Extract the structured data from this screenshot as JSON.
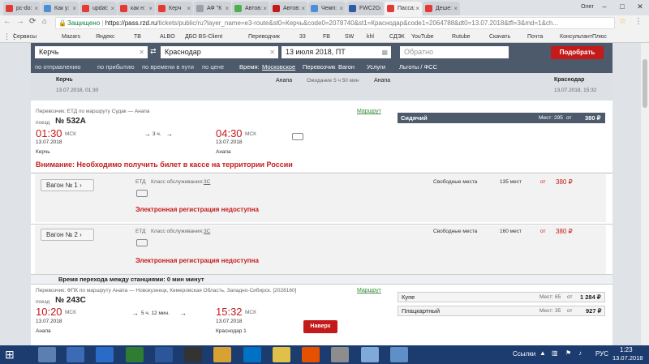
{
  "browser": {
    "tabs": [
      {
        "label": "pc-do:",
        "icon": "yandex-icon",
        "color": "#e53935"
      },
      {
        "label": "Как у:",
        "icon": "page-icon",
        "color": "#4a90d9"
      },
      {
        "label": "updat:",
        "icon": "yandex-icon",
        "color": "#e53935"
      },
      {
        "label": "как н:",
        "icon": "yandex-icon",
        "color": "#e53935"
      },
      {
        "label": "Керч",
        "icon": "rzd-icon",
        "color": "#e53935"
      },
      {
        "label": "АФ \"К",
        "icon": "page-icon",
        "color": "#9aa0a6"
      },
      {
        "label": "Автов:",
        "icon": "page-icon",
        "color": "#4caf50"
      },
      {
        "label": "Автов:",
        "icon": "page-icon",
        "color": "#c41a1a"
      },
      {
        "label": "Чемп:",
        "icon": "page-icon",
        "color": "#4a90d9"
      },
      {
        "label": "FWC2C",
        "icon": "page-icon",
        "color": "#2e5aa8"
      },
      {
        "label": "Пасса:",
        "icon": "rzd-icon",
        "color": "#e53935",
        "active": true
      },
      {
        "label": "Деше:",
        "icon": "page-icon",
        "color": "#e53935"
      }
    ],
    "user": "Олег",
    "secure_label": "Защищено",
    "url_host": "https://pass.rzd.ru",
    "url_path": "/tickets/public/ru?layer_name=e3-route&st0=Керчь&code0=2078740&st1=Краснодар&code1=2064788&dt0=13.07.2018&tfl=3&md=1&ch...",
    "bookmarks": [
      "Сервисы",
      "Mazars",
      "Яндекс",
      "TB",
      "ALBO",
      "ДБО BS-Client",
      "Переводчик",
      "33",
      "FB",
      "SW",
      "khl",
      "СДЭК",
      "YouTube",
      "Rutube",
      "Скачать",
      "Почта",
      "КонсультантПлюс"
    ]
  },
  "search": {
    "from": "Керчь",
    "to": "Краснодар",
    "date": "13 июля 2018, ПТ",
    "return_placeholder": "Обратно",
    "find_label": "Подобрать"
  },
  "filters": {
    "items": [
      "по отправлению",
      "по прибытию",
      "по времени в пути",
      "по цене"
    ],
    "time_label": "Время:",
    "time_value": "Московское",
    "carrier": "Перевозчик",
    "wagon": "Вагон",
    "services": "Услуги",
    "benefits": "Льготы / ФСС"
  },
  "route": {
    "from_city": "Керчь",
    "from_dt": "13.07.2018, 01:30",
    "mid1": "Анапа",
    "wait": "Ожидание 5 ч 50 мин",
    "mid2": "Анапа",
    "to_city": "Краснодар",
    "to_dt": "13.07.2018, 15:32"
  },
  "train1": {
    "carrier_line": "Перевозчик: ЕТД   по маршруту Судак — Анапа",
    "route_link": "Маршрут",
    "kind": "поезд",
    "number": "№ 532А",
    "dep_time": "01:30",
    "dep_tz": "МСК",
    "dep_date": "13.07.2018",
    "dep_station": "Керчь",
    "duration": "3 ч.",
    "arr_time": "04:30",
    "arr_tz": "МСК",
    "arr_date": "13.07.2018",
    "arr_station": "Анапа",
    "offer_name": "Сидячий",
    "offer_seats_label": "Мест:",
    "offer_seats": "295",
    "offer_from": "от",
    "offer_price": "380 ₽",
    "warning": "Внимание: Необходимо получить билет в кассе на территории России",
    "wagons": [
      {
        "label": "Вагон  № 1",
        "carrier": "ЕТД",
        "class_label": "Класс обслуживания:",
        "class": "3С",
        "free_label": "Свободные места",
        "free": "135 мест",
        "from": "от",
        "price": "380 ₽",
        "ereg": "Электронная регистрация недоступна"
      },
      {
        "label": "Вагон  № 2",
        "carrier": "ЕТД",
        "class_label": "Класс обслуживания:",
        "class": "3С",
        "free_label": "Свободные места",
        "free": "160 мест",
        "from": "от",
        "price": "380 ₽",
        "ereg": "Электронная регистрация недоступна"
      }
    ]
  },
  "transfer": "Время перехода между станциями: 0 мин минут",
  "train2": {
    "carrier_line": "Перевозчик: ФПК   по маршруту Анапа — Новокузнецк, Кемеровская Область, Западно-Сибирск. [2028160]",
    "route_link": "Маршрут",
    "kind": "поезд",
    "number": "№ 243С",
    "dep_time": "10:20",
    "dep_tz": "МСК",
    "dep_date": "13.07.2018",
    "dep_station": "Анапа",
    "duration": "5 ч. 12 мин.",
    "arr_time": "15:32",
    "arr_tz": "МСК",
    "arr_date": "13.07.2018",
    "arr_station": "Краснодар 1",
    "back_label": "Наверх",
    "offers": [
      {
        "name": "Купе",
        "seats_label": "Мест:",
        "seats": "65",
        "from": "от",
        "price": "1 284 ₽"
      },
      {
        "name": "Плацкартный",
        "seats_label": "Мест:",
        "seats": "35",
        "from": "от",
        "price": "927 ₽"
      }
    ]
  },
  "taskbar": {
    "links_label": "Ссылки",
    "lang": "РУС",
    "time": "1:23",
    "date": "13.07.2018"
  }
}
